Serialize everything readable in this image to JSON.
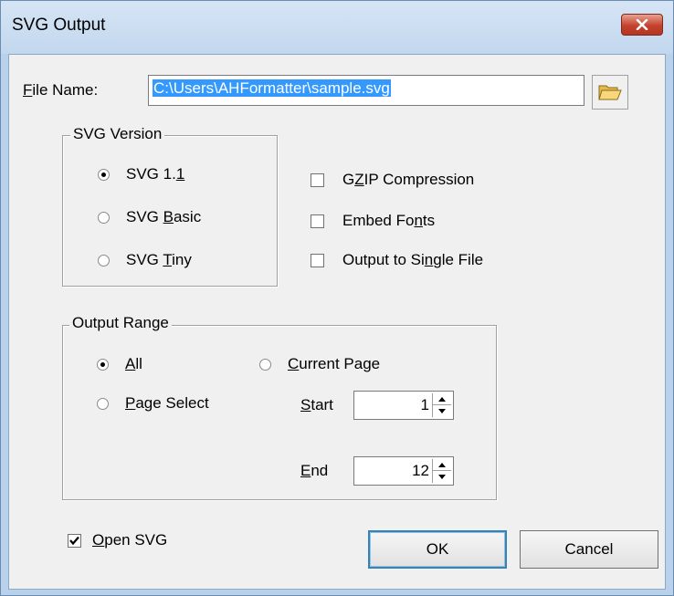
{
  "window": {
    "title": "SVG Output",
    "close_icon": "close-icon"
  },
  "file": {
    "label_prefix": "",
    "label_mnemonic": "F",
    "label_rest": "ile Name:",
    "value": "C:\\Users\\AHFormatter\\sample.svg",
    "browse_icon": "open-folder-icon"
  },
  "svg_version": {
    "title": "SVG Version",
    "options": [
      {
        "pre": "SVG 1.",
        "mn": "1",
        "post": "",
        "selected": true
      },
      {
        "pre": "SVG ",
        "mn": "B",
        "post": "asic",
        "selected": false
      },
      {
        "pre": "SVG ",
        "mn": "T",
        "post": "iny",
        "selected": false
      }
    ]
  },
  "options": [
    {
      "pre": "G",
      "mn": "Z",
      "post": "IP Compression",
      "checked": false
    },
    {
      "pre": "Embed Fo",
      "mn": "n",
      "post": "ts",
      "checked": false
    },
    {
      "pre": "Output to Si",
      "mn": "n",
      "post": "gle File",
      "checked": false
    }
  ],
  "output_range": {
    "title": "Output Range",
    "all": {
      "pre": "",
      "mn": "A",
      "post": "ll",
      "selected": true
    },
    "current_page": {
      "pre": "",
      "mn": "C",
      "post": "urrent Page",
      "selected": false
    },
    "page_select": {
      "pre": "",
      "mn": "P",
      "post": "age Select",
      "selected": false
    },
    "start": {
      "pre": "",
      "mn": "S",
      "post": "tart",
      "value": "1"
    },
    "end": {
      "pre": "",
      "mn": "E",
      "post": "nd",
      "value": "12"
    }
  },
  "open_svg": {
    "pre": "",
    "mn": "O",
    "post": "pen SVG",
    "checked": true
  },
  "buttons": {
    "ok": "OK",
    "cancel": "Cancel"
  }
}
